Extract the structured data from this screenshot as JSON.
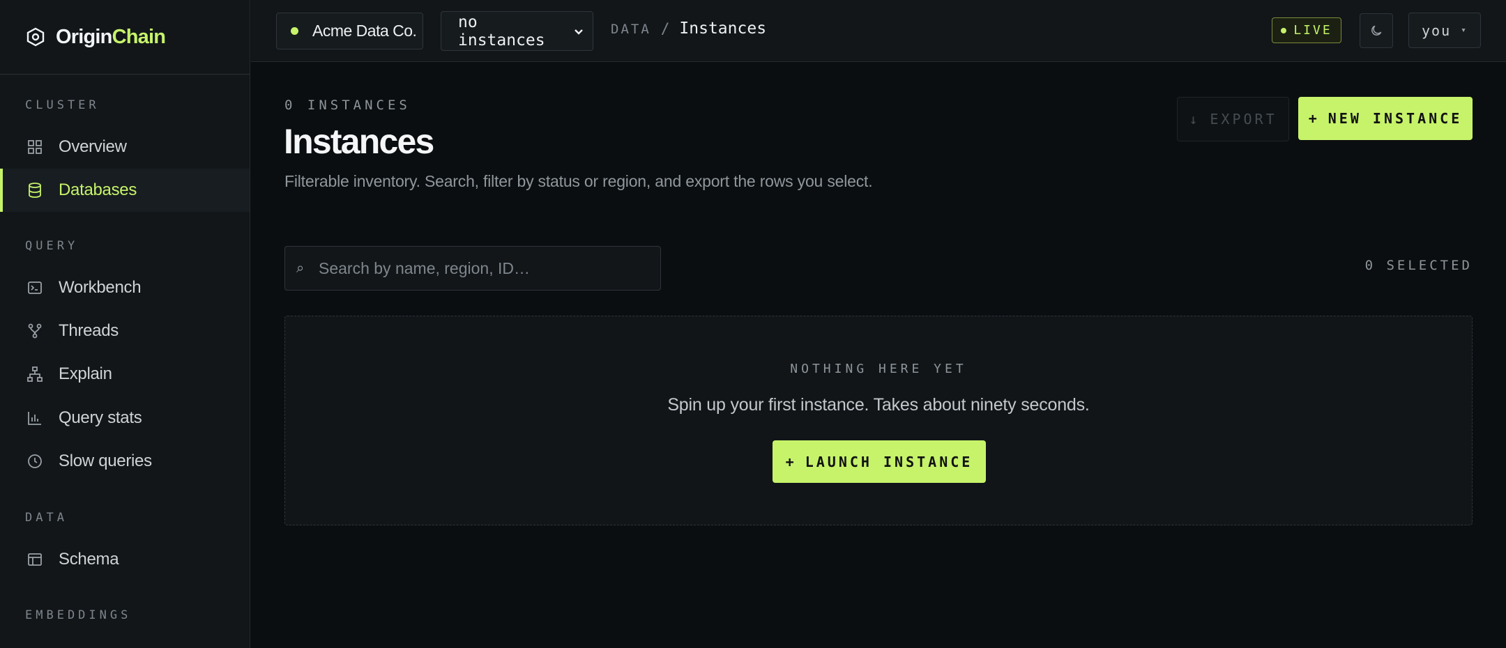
{
  "brand": {
    "name_part1": "Origin",
    "name_part2": "Chain",
    "logo_icon": "hexagon-icon"
  },
  "sidebar": {
    "sections": {
      "cluster": "CLUSTER",
      "query": "QUERY",
      "data": "DATA",
      "embeddings": "EMBEDDINGS"
    },
    "items": [
      {
        "label": "Overview",
        "icon": "grid-icon",
        "active": false
      },
      {
        "label": "Databases",
        "icon": "database-icon",
        "active": true
      },
      {
        "label": "Workbench",
        "icon": "terminal-icon",
        "active": false
      },
      {
        "label": "Threads",
        "icon": "branch-icon",
        "active": false
      },
      {
        "label": "Explain",
        "icon": "hierarchy-icon",
        "active": false
      },
      {
        "label": "Query stats",
        "icon": "bar-chart-icon",
        "active": false
      },
      {
        "label": "Slow queries",
        "icon": "clock-icon",
        "active": false
      },
      {
        "label": "Schema",
        "icon": "table-icon",
        "active": false
      }
    ]
  },
  "topbar": {
    "org": "Acme Data Co.",
    "instance_select": {
      "selected": "no instances",
      "options": [
        "no instances"
      ]
    },
    "breadcrumb": {
      "parent": "DATA",
      "separator": "/",
      "current": "Instances"
    },
    "live_badge": "LIVE",
    "theme_icon": "moon-icon",
    "user": "you",
    "user_caret": "▾"
  },
  "main": {
    "count_label": "0 INSTANCES",
    "title": "Instances",
    "subtitle": "Filterable inventory. Search, filter by status or region, and export the rows you select.",
    "export_button": {
      "icon": "↓",
      "label": "EXPORT",
      "enabled": false
    },
    "new_button": {
      "icon": "+",
      "label": "NEW INSTANCE"
    },
    "search": {
      "icon": "⌕",
      "placeholder": "Search by name, region, ID…",
      "value": ""
    },
    "selected_label": "0 SELECTED",
    "empty_state": {
      "title": "NOTHING HERE YET",
      "text": "Spin up your first instance. Takes about ninety seconds.",
      "button_icon": "+",
      "button_label": "LAUNCH INSTANCE"
    }
  },
  "colors": {
    "accent": "#c6f36a",
    "background": "#0b0e10",
    "panel": "#121619"
  }
}
